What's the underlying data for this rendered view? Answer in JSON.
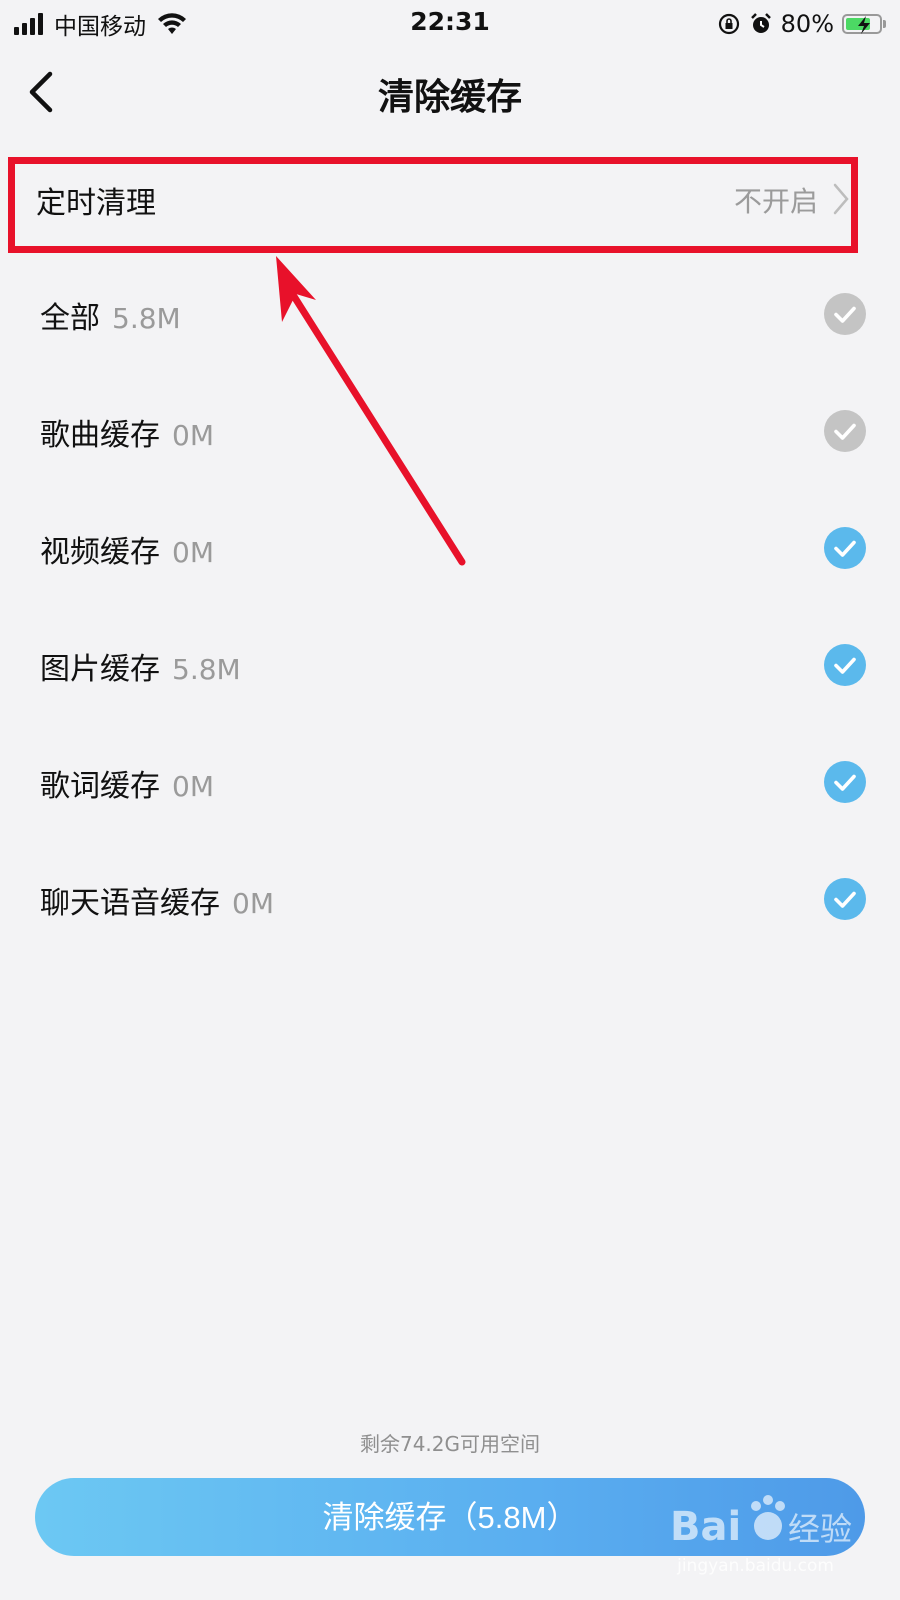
{
  "status_bar": {
    "carrier": "中国移动",
    "time": "22:31",
    "battery": "80%",
    "battery_level": 0.8
  },
  "nav": {
    "title": "清除缓存"
  },
  "timed_clean": {
    "label": "定时清理",
    "value": "不开启"
  },
  "cache_items": [
    {
      "label": "全部",
      "size": "5.8M",
      "checked": false
    },
    {
      "label": "歌曲缓存",
      "size": "0M",
      "checked": false
    },
    {
      "label": "视频缓存",
      "size": "0M",
      "checked": true
    },
    {
      "label": "图片缓存",
      "size": "5.8M",
      "checked": true
    },
    {
      "label": "歌词缓存",
      "size": "0M",
      "checked": true
    },
    {
      "label": "聊天语音缓存",
      "size": "0M",
      "checked": true
    }
  ],
  "storage_note": "剩余74.2G可用空间",
  "clear_button": "清除缓存（5.8M）",
  "watermark": {
    "site": "jingyan.baidu.com"
  },
  "colors": {
    "highlight": "#e8112a",
    "check_on": "#5bb9ec",
    "check_off": "#c4c4c4",
    "accent": "#5aaef0"
  }
}
